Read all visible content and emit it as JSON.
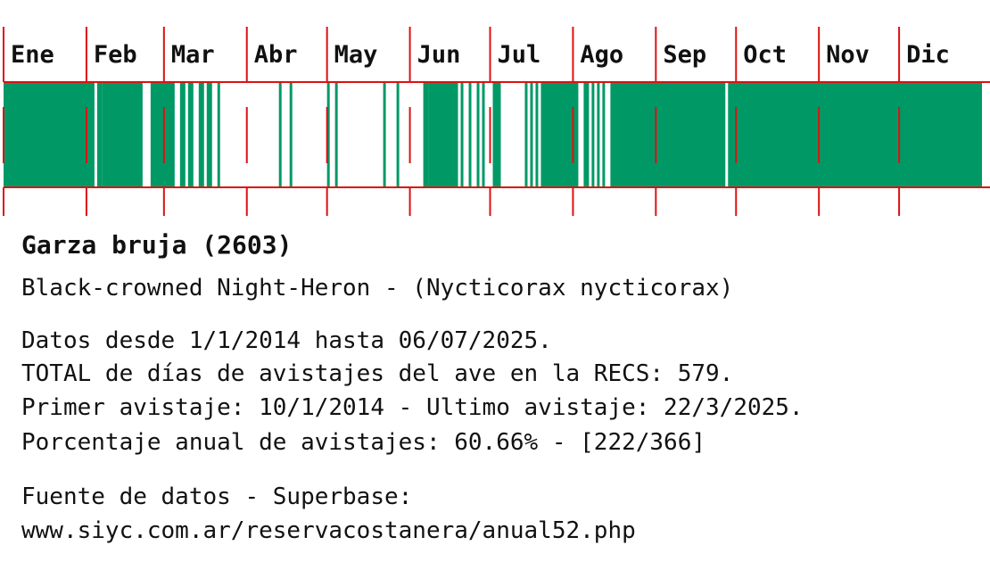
{
  "chart_data": {
    "type": "bar",
    "title": "",
    "xlabel": "",
    "ylabel": "",
    "categories": [
      "Ene",
      "Feb",
      "Mar",
      "Abr",
      "May",
      "Jun",
      "Jul",
      "Ago",
      "Sep",
      "Oct",
      "Nov",
      "Dic"
    ],
    "days_per_month": [
      31,
      29,
      31,
      30,
      31,
      30,
      31,
      31,
      30,
      31,
      30,
      31
    ],
    "presence_day_ranges": [
      [
        1,
        34
      ],
      [
        36,
        37
      ],
      [
        38,
        52
      ],
      [
        56,
        64
      ],
      [
        67,
        68
      ],
      [
        70,
        71
      ],
      [
        74,
        75
      ],
      [
        77,
        78
      ],
      [
        81,
        81
      ],
      [
        104,
        104
      ],
      [
        108,
        108
      ],
      [
        122,
        122
      ],
      [
        125,
        125
      ],
      [
        143,
        143
      ],
      [
        148,
        148
      ],
      [
        158,
        159
      ],
      [
        160,
        170
      ],
      [
        172,
        172
      ],
      [
        175,
        175
      ],
      [
        178,
        178
      ],
      [
        180,
        180
      ],
      [
        184,
        186
      ],
      [
        196,
        196
      ],
      [
        198,
        198
      ],
      [
        200,
        200
      ],
      [
        202,
        215
      ],
      [
        218,
        219
      ],
      [
        221,
        221
      ],
      [
        223,
        223
      ],
      [
        225,
        225
      ],
      [
        228,
        270
      ],
      [
        272,
        366
      ]
    ],
    "colors": {
      "presence": "#009966",
      "month_lines": "#dd1111"
    }
  },
  "species": {
    "common_name": "Garza bruja (2603)",
    "english_scientific": "Black-crowned Night-Heron - (Nycticorax nycticorax)"
  },
  "stats": {
    "range": "Datos desde 1/1/2014 hasta 06/07/2025.",
    "total": "TOTAL de días de avistajes del ave en la RECS: 579.",
    "first_last": "Primer avistaje: 10/1/2014 - Ultimo avistaje: 22/3/2025.",
    "percentage": "Porcentaje anual de avistajes: 60.66% - [222/366]"
  },
  "source": {
    "label": "Fuente de datos - Superbase:",
    "url": "www.siyc.com.ar/reservacostanera/anual52.php"
  }
}
